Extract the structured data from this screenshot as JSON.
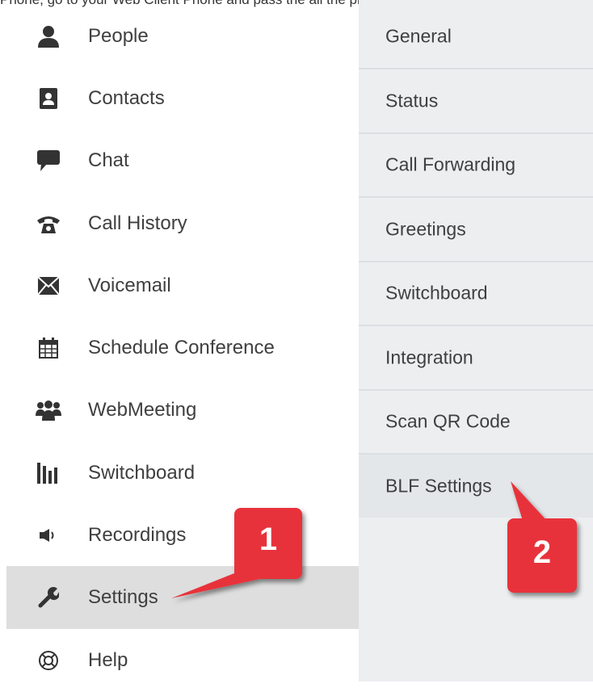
{
  "top_text": "Phone, go to your Web Client Phone and pass the all the phone system",
  "left_menu": {
    "items": [
      {
        "label": "People",
        "icon": "person-icon"
      },
      {
        "label": "Contacts",
        "icon": "address-book-icon"
      },
      {
        "label": "Chat",
        "icon": "chat-bubble-icon"
      },
      {
        "label": "Call History",
        "icon": "phone-icon"
      },
      {
        "label": "Voicemail",
        "icon": "envelope-icon"
      },
      {
        "label": "Schedule Conference",
        "icon": "calendar-icon"
      },
      {
        "label": "WebMeeting",
        "icon": "group-icon"
      },
      {
        "label": "Switchboard",
        "icon": "bar-chart-icon"
      },
      {
        "label": "Recordings",
        "icon": "speaker-icon"
      },
      {
        "label": "Settings",
        "icon": "wrench-icon",
        "active": true
      },
      {
        "label": "Help",
        "icon": "lifebuoy-icon"
      }
    ]
  },
  "right_menu": {
    "items": [
      {
        "label": "General"
      },
      {
        "label": "Status"
      },
      {
        "label": "Call Forwarding"
      },
      {
        "label": "Greetings"
      },
      {
        "label": "Switchboard"
      },
      {
        "label": "Integration"
      },
      {
        "label": "Scan QR Code"
      },
      {
        "label": "BLF Settings",
        "active": true
      }
    ]
  },
  "callouts": {
    "one": "1",
    "two": "2",
    "color": "#e8303a"
  }
}
